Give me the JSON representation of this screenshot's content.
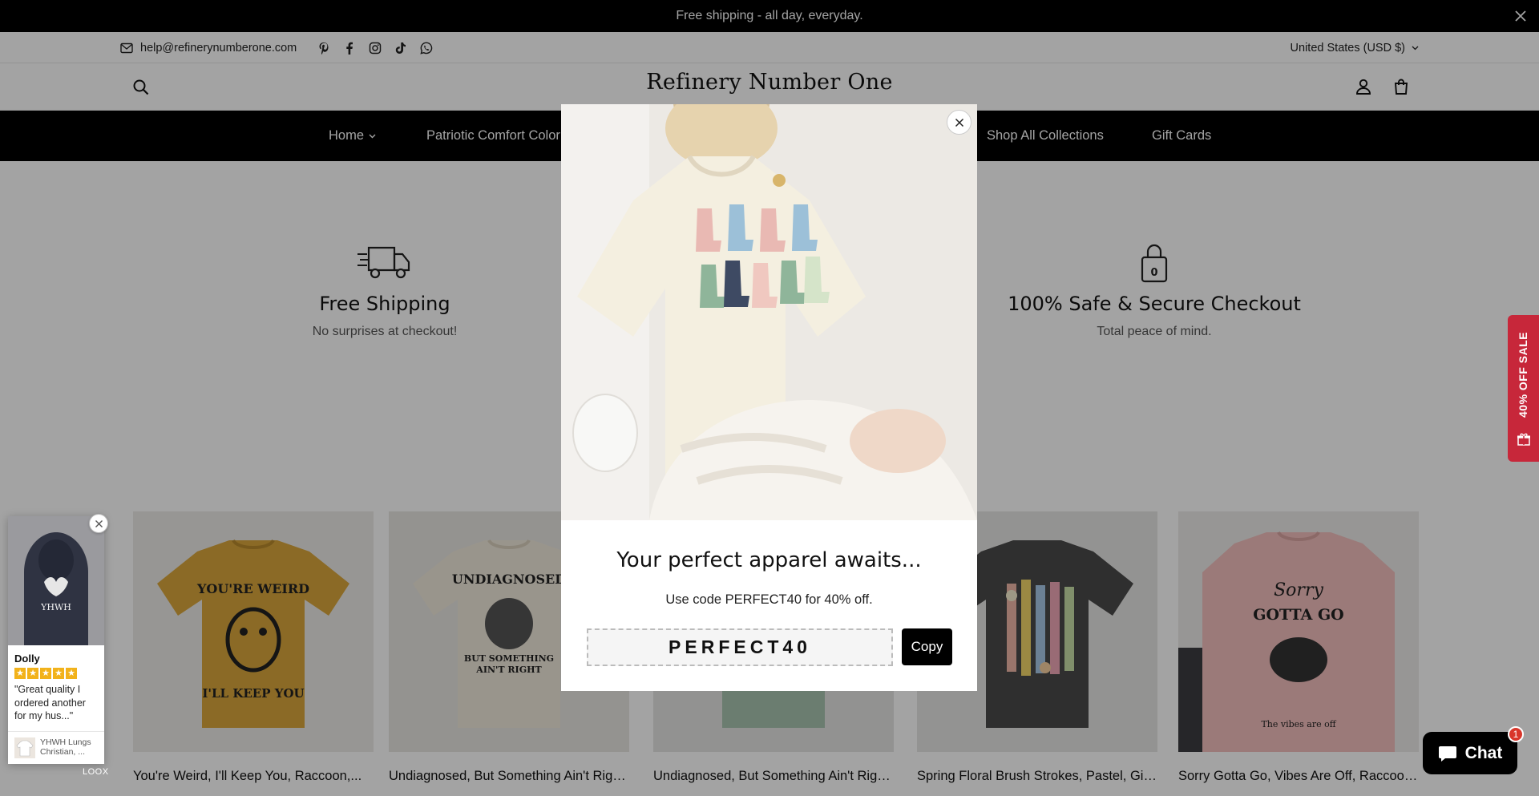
{
  "announcement": {
    "text": "Free shipping - all day, everyday."
  },
  "topbar": {
    "email": "help@refinerynumberone.com",
    "socials": [
      "pinterest-icon",
      "facebook-icon",
      "instagram-icon",
      "tiktok-icon",
      "whatsapp-icon"
    ],
    "currency": "United States (USD $)"
  },
  "header": {
    "logo": "Refinery Number One"
  },
  "nav": {
    "home": "Home",
    "patriotic": "Patriotic Comfort Color",
    "shop_all": "Shop All Collections",
    "gift_cards": "Gift Cards"
  },
  "features": [
    {
      "title": "Free Shipping",
      "text": "No surprises at checkout!",
      "icon": "truck-icon"
    },
    {
      "title": "100% Safe & Secure Checkout",
      "text": "Total peace of mind.",
      "icon": "lock-icon"
    }
  ],
  "products": [
    {
      "title": "You're Weird, I'll Keep You, Raccoon,...",
      "shirt_text": [
        "YOU'RE WEIRD",
        "I'LL KEEP YOU"
      ],
      "color": "#d9a63c"
    },
    {
      "title": "Undiagnosed, But Something Ain't Right..",
      "shirt_text": [
        "UNDIAGNOSED",
        "BUT SOMETHING",
        "AIN'T RIGHT"
      ],
      "color": "#f0e9dc"
    },
    {
      "title": "Undiagnosed, But Something Ain't Right..",
      "shirt_text": [],
      "color": "#a8c4b0"
    },
    {
      "title": "Spring Floral Brush Strokes, Pastel, Girly..",
      "shirt_text": [],
      "color": "#4a4a4a"
    },
    {
      "title": "Sorry Gotta Go, Vibes Are Off, Raccoon..",
      "shirt_text": [
        "Sorry",
        "GOTTA GO",
        "The vibes are off"
      ],
      "color": "#f2bfbd"
    }
  ],
  "side_tab": {
    "label": "40% OFF SALE"
  },
  "loox": {
    "reviewer": "Dolly",
    "rating": 5,
    "quote": "\"Great quality I ordered another for my hus...\"",
    "product": "YHWH Lungs Christian, ...",
    "photo_text": "YHWH",
    "brand": "LOOX"
  },
  "chat": {
    "label": "Chat",
    "badge": "1"
  },
  "modal": {
    "heading": "Your perfect apparel awaits...",
    "subtext": "Use code PERFECT40 for 40% off.",
    "code": "PERFECT40",
    "copy_label": "Copy"
  },
  "colors": {
    "accent": "#000000",
    "sale_tab": "#c7273a",
    "star": "#f2b21a"
  }
}
